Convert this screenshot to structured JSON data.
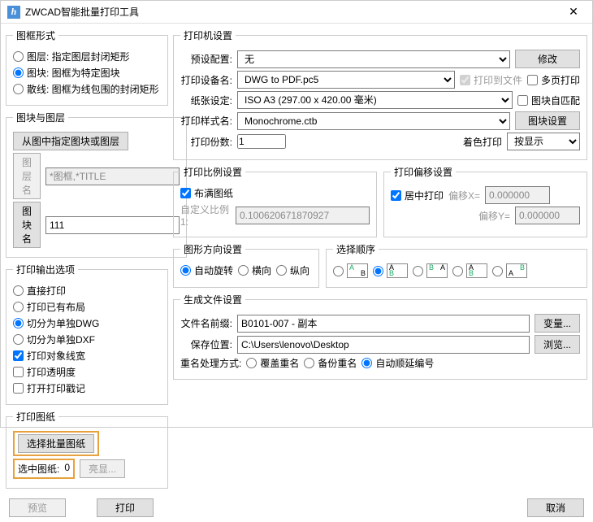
{
  "title": "ZWCAD智能批量打印工具",
  "frame_form": {
    "legend": "图框形式",
    "opts": [
      {
        "label": "图层: 指定图层封闭矩形",
        "checked": false
      },
      {
        "label": "图块: 图框为特定图块",
        "checked": true
      },
      {
        "label": "散线: 图框为线包围的封闭矩形",
        "checked": false
      }
    ]
  },
  "block_layer": {
    "legend": "图块与图层",
    "pick_btn": "从图中指定图块或图层",
    "layer_btn": "图层名",
    "layer_val": "*图框,*TITLE",
    "block_btn": "图块名",
    "block_val": "111"
  },
  "output": {
    "legend": "打印输出选项",
    "opts": [
      {
        "label": "直接打印",
        "type": "radio",
        "checked": false
      },
      {
        "label": "打印已有布局",
        "type": "radio",
        "checked": false
      },
      {
        "label": "切分为单独DWG",
        "type": "radio",
        "checked": true
      },
      {
        "label": "切分为单独DXF",
        "type": "radio",
        "checked": false
      },
      {
        "label": "打印对象线宽",
        "type": "check",
        "checked": true
      },
      {
        "label": "打印透明度",
        "type": "check",
        "checked": false
      },
      {
        "label": "打开打印戳记",
        "type": "check",
        "checked": false
      }
    ]
  },
  "sheets": {
    "legend": "打印图纸",
    "select_btn": "选择批量图纸",
    "selected_lbl": "选中图纸:",
    "count": "0",
    "hl_btn": "亮显..."
  },
  "printer": {
    "legend": "打印机设置",
    "preset_lbl": "预设配置:",
    "preset_val": "无",
    "modify": "修改",
    "device_lbl": "打印设备名:",
    "device_val": "DWG to PDF.pc5",
    "tofile": "打印到文件",
    "multi": "多页打印",
    "paper_lbl": "纸张设定:",
    "paper_val": "ISO A3 (297.00 x 420.00 毫米)",
    "automatch": "图块自匹配",
    "style_lbl": "打印样式名:",
    "style_val": "Monochrome.ctb",
    "blockset": "图块设置",
    "copies_lbl": "打印份数:",
    "copies_val": "1",
    "color_lbl": "着色打印",
    "color_val": "按显示"
  },
  "scale": {
    "legend": "打印比例设置",
    "fit": "布满图纸",
    "custom_lbl": "自定义比例1:",
    "custom_val": "0.100620671870927"
  },
  "offset": {
    "legend": "打印偏移设置",
    "center": "居中打印",
    "x_lbl": "偏移X=",
    "x_val": "0.000000",
    "y_lbl": "偏移Y=",
    "y_val": "0.000000"
  },
  "orient": {
    "legend": "图形方向设置",
    "auto": "自动旋转",
    "h": "横向",
    "v": "纵向"
  },
  "order": {
    "legend": "选择顺序"
  },
  "gen": {
    "legend": "生成文件设置",
    "prefix_lbl": "文件名前缀:",
    "prefix_val": "B0101-007 - 副本",
    "var_btn": "变量...",
    "path_lbl": "保存位置:",
    "path_val": "C:\\Users\\lenovo\\Desktop",
    "browse": "浏览...",
    "dup_lbl": "重名处理方式:",
    "dup_opts": [
      "覆盖重名",
      "备份重名",
      "自动顺延编号"
    ]
  },
  "footer": {
    "preview": "预览",
    "print": "打印",
    "cancel": "取消"
  }
}
